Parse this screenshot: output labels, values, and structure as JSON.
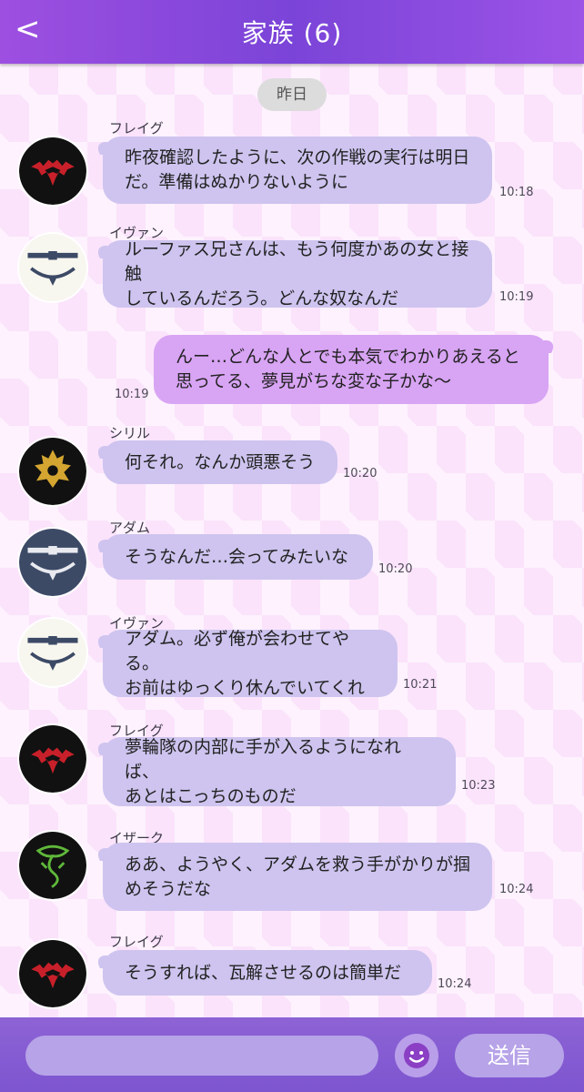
{
  "header": {
    "title": "家族 (6)",
    "back_label": "<"
  },
  "date_separator": "昨日",
  "messages": [
    {
      "sender": "フレイグ",
      "lines": [
        "昨夜確認したように、次の作戦の実行は明日",
        "だ。準備はぬかりないように"
      ],
      "time": "10:18",
      "avatar": "red-crest-icon"
    },
    {
      "sender": "イヴァン",
      "lines": [
        "ルーファス兄さんは、もう何度かあの女と接触",
        "しているんだろう。どんな奴なんだ"
      ],
      "time": "10:19",
      "avatar": "choker-crest-icon"
    },
    {
      "sender": "",
      "lines": [
        "んー…どんな人とでも本気でわかりあえると",
        "思ってる、夢見がちな変な子かな〜"
      ],
      "time": "10:19",
      "mine": true
    },
    {
      "sender": "シリル",
      "lines": [
        "何それ。なんか頭悪そう"
      ],
      "time": "10:20",
      "avatar": "gold-crest-icon"
    },
    {
      "sender": "アダム",
      "lines": [
        "そうなんだ…会ってみたいな"
      ],
      "time": "10:20",
      "avatar": "navy-choker-crest-icon"
    },
    {
      "sender": "イヴァン",
      "lines": [
        "アダム。必ず俺が会わせてやる。",
        "お前はゆっくり休んでいてくれ"
      ],
      "time": "10:21",
      "avatar": "choker-crest-icon"
    },
    {
      "sender": "フレイグ",
      "lines": [
        "夢輪隊の内部に手が入るようになれば、",
        "あとはこっちのものだ"
      ],
      "time": "10:23",
      "avatar": "red-crest-icon"
    },
    {
      "sender": "イザーク",
      "lines": [
        "ああ、ようやく、アダムを救う手がかりが掴",
        "めそうだな"
      ],
      "time": "10:24",
      "avatar": "green-dragon-crest-icon"
    },
    {
      "sender": "フレイグ",
      "lines": [
        "そうすれば、瓦解させるのは簡単だ"
      ],
      "time": "10:24",
      "avatar": "red-crest-icon"
    }
  ],
  "footer": {
    "input_placeholder": "",
    "send_label": "送信",
    "emoji_icon": "smiley-icon"
  },
  "colors": {
    "header": "#7b44d8",
    "bubble_other": "#cec4ef",
    "bubble_mine": "#d8a4f4",
    "footer": "#8d63d5"
  }
}
